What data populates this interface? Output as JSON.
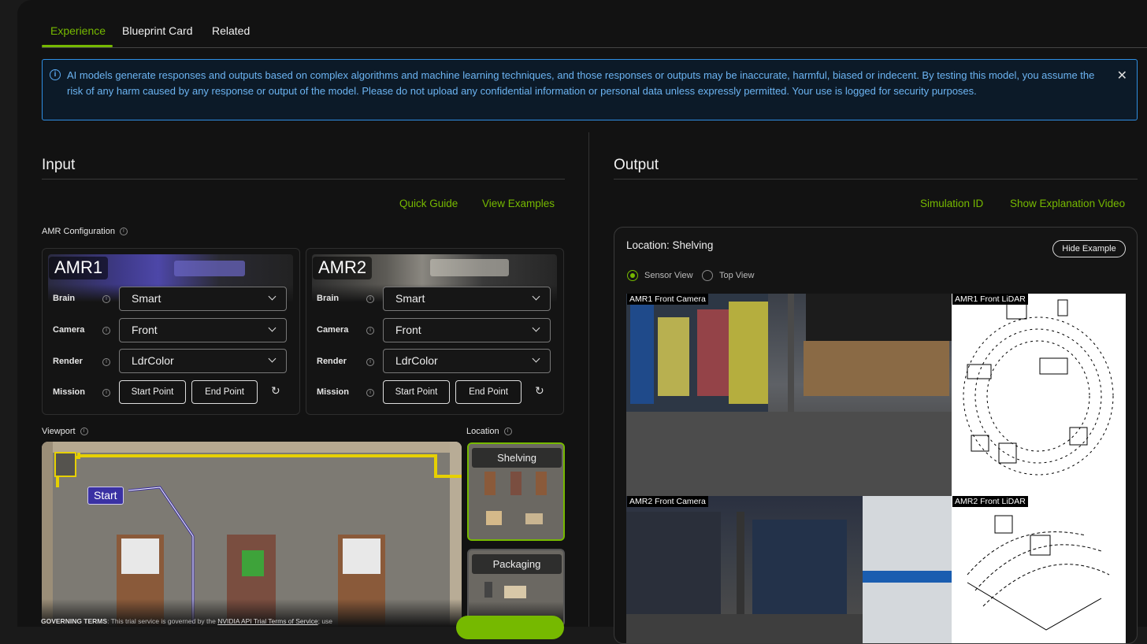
{
  "tabs": [
    {
      "label": "Experience"
    },
    {
      "label": "Blueprint Card"
    },
    {
      "label": "Related"
    }
  ],
  "banner": {
    "text": "AI models generate responses and outputs based on complex algorithms and machine learning techniques, and those responses or outputs may be inaccurate, harmful, biased or indecent. By testing this model, you assume the risk of any harm caused by any response or output of the model. Please do not upload any confidential information or personal data unless expressly permitted. Your use is logged for security purposes.",
    "info_icon": "i",
    "close_icon": "✕"
  },
  "input": {
    "title": "Input",
    "quick_guide": "Quick Guide",
    "view_examples": "View Examples",
    "amr_config_label": "AMR Configuration",
    "amrs": [
      {
        "title": "AMR1",
        "brain_label": "Brain",
        "brain": "Smart",
        "camera_label": "Camera",
        "camera": "Front",
        "render_label": "Render",
        "render": "LdrColor",
        "mission_label": "Mission",
        "start_point": "Start Point",
        "end_point": "End Point"
      },
      {
        "title": "AMR2",
        "brain_label": "Brain",
        "brain": "Smart",
        "camera_label": "Camera",
        "camera": "Front",
        "render_label": "Render",
        "render": "LdrColor",
        "mission_label": "Mission",
        "start_point": "Start Point",
        "end_point": "End Point"
      }
    ],
    "viewport_label": "Viewport",
    "start_marker": "Start",
    "location_label": "Location",
    "locations": [
      {
        "label": "Shelving",
        "selected": true
      },
      {
        "label": "Packaging",
        "selected": false
      }
    ]
  },
  "governing": {
    "bold": "GOVERNING TERMS",
    "text": ": This trial service is governed by the ",
    "link": "NVIDIA API Trial Terms of Service",
    "tail": "; use"
  },
  "output": {
    "title": "Output",
    "simulation_id": "Simulation ID",
    "show_video": "Show Explanation Video",
    "location_text": "Location: Shelving",
    "hide_example": "Hide Example",
    "sensor_view": "Sensor View",
    "top_view": "Top View",
    "feeds": {
      "amr1_camera": "AMR1 Front Camera",
      "amr1_lidar": "AMR1 Front LiDAR",
      "amr2_camera": "AMR2 Front Camera",
      "amr2_lidar": "AMR2 Front LiDAR"
    }
  },
  "colors": {
    "accent": "#76b900",
    "info": "#2f8fe3"
  }
}
